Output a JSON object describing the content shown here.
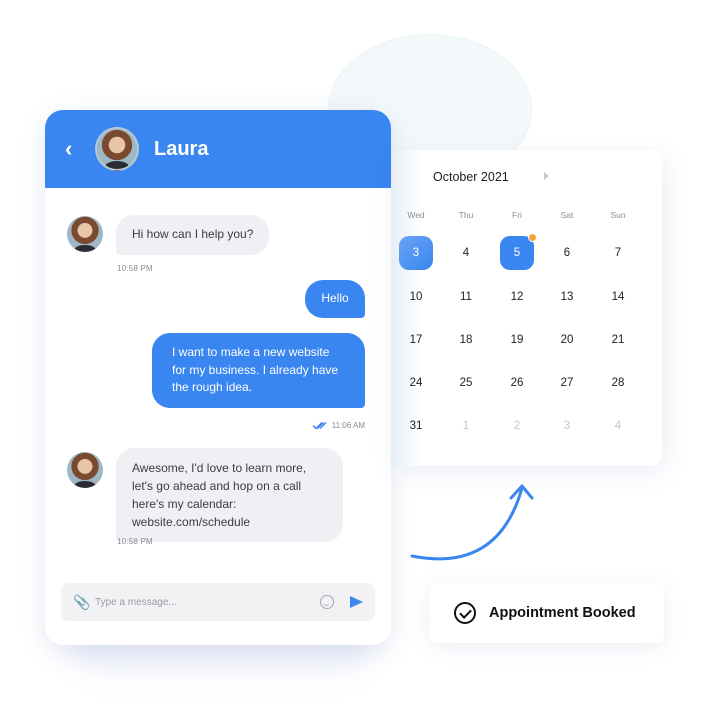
{
  "chat": {
    "contact_name": "Laura",
    "back_icon": "chevron-left-icon",
    "messages": [
      {
        "direction": "incoming",
        "text": "Hi how can I help you?",
        "time": "10:58 PM"
      },
      {
        "direction": "outgoing",
        "text": "Hello"
      },
      {
        "direction": "outgoing",
        "text": "I want to make a new website for my business. I already have the rough idea.",
        "time": "11:06 AM",
        "status": "read"
      },
      {
        "direction": "incoming",
        "text": "Awesome, I'd love to learn more, let's go ahead and hop on a call here's my calendar: website.com/schedule",
        "time": "10:58 PM"
      }
    ],
    "input": {
      "placeholder": "Type a message...",
      "value": ""
    },
    "icons": {
      "attach": "paperclip-icon",
      "emoji": "smiley-icon",
      "send": "send-icon"
    }
  },
  "calendar": {
    "title": "October 2021",
    "weekdays": [
      "Wed",
      "Thu",
      "Fri",
      "Sat",
      "Sun"
    ],
    "weeks": [
      [
        "3",
        "4",
        "5",
        "6",
        "7"
      ],
      [
        "10",
        "11",
        "12",
        "13",
        "14"
      ],
      [
        "17",
        "18",
        "19",
        "20",
        "21"
      ],
      [
        "24",
        "25",
        "26",
        "27",
        "28"
      ],
      [
        "31",
        "1",
        "2",
        "3",
        "4"
      ]
    ],
    "selected": [
      "3",
      "5"
    ],
    "event_marker_day": "5",
    "next_month_days": [
      "1",
      "2",
      "3",
      "4"
    ]
  },
  "confirmation": {
    "label": "Appointment Booked",
    "icon": "check-circle-icon"
  },
  "colors": {
    "accent": "#3a86f0",
    "marker": "#f6a13a"
  }
}
